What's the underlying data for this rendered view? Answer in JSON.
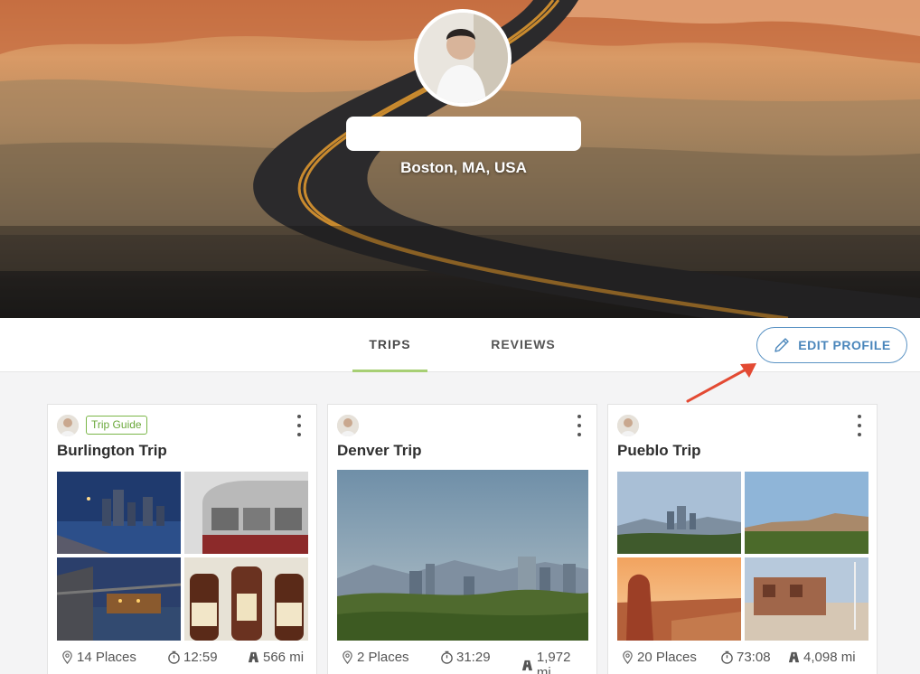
{
  "profile": {
    "location": "Boston, MA, USA"
  },
  "tabs": {
    "trips": "TRIPS",
    "reviews": "REVIEWS",
    "edit_profile": "EDIT PROFILE"
  },
  "icons": {
    "edit": "pencil-icon",
    "menu": "kebab-menu-icon",
    "places": "map-pin-icon",
    "duration": "stopwatch-icon",
    "distance": "road-icon"
  },
  "colors": {
    "accent_green": "#a7cf74",
    "accent_blue": "#4a86bb",
    "arrow_red": "#e34a33"
  },
  "trips": [
    {
      "title": "Burlington Trip",
      "badge": "Trip Guide",
      "places": "14 Places",
      "duration": "12:59",
      "distance": "566 mi"
    },
    {
      "title": "Denver Trip",
      "badge": "",
      "places": "2 Places",
      "duration": "31:29",
      "distance": "1,972 mi"
    },
    {
      "title": "Pueblo Trip",
      "badge": "",
      "places": "20 Places",
      "duration": "73:08",
      "distance": "4,098 mi"
    }
  ]
}
